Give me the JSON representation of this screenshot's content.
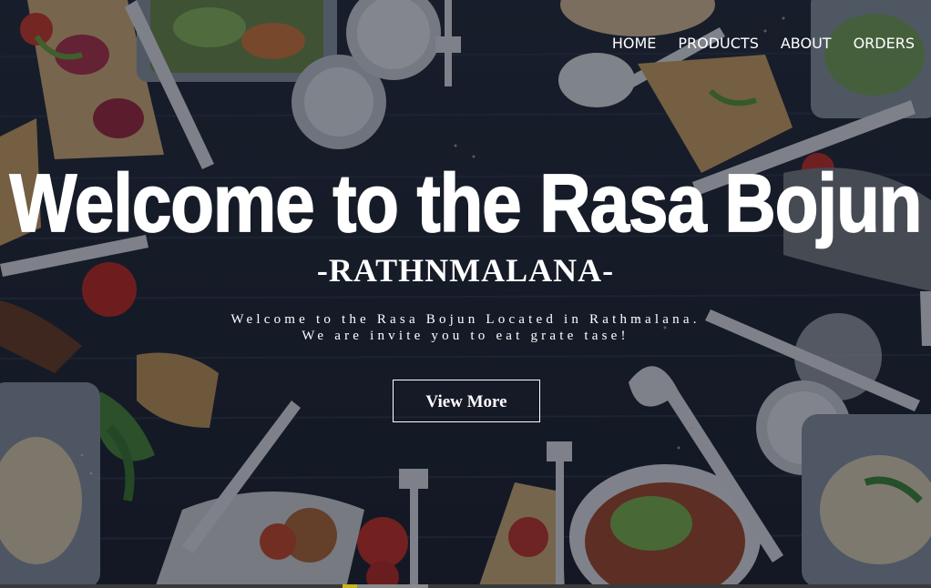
{
  "nav": {
    "items": [
      {
        "label": "HOME"
      },
      {
        "label": "PRODUCTS"
      },
      {
        "label": "ABOUT"
      },
      {
        "label": "ORDERS"
      }
    ]
  },
  "hero": {
    "title": "Welcome to the Rasa Bojun",
    "subtitle": "-RATHNMALANA-",
    "tagline_line1": "Welcome to the Rasa Bojun Located in Rathmalana.",
    "tagline_line2": "We are invite you to eat grate tase!",
    "cta_label": "View More",
    "background_image": "food-table-background",
    "overlay_color": "#0c101e"
  },
  "colors": {
    "text": "#ffffff",
    "table": "#1c2230"
  }
}
